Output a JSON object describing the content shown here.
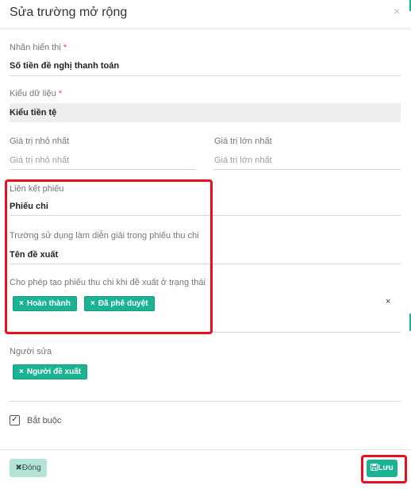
{
  "dialog": {
    "title": "Sửa trường mở rộng",
    "close_glyph": "×"
  },
  "fields": {
    "display_label": {
      "label": "Nhãn hiển thị",
      "required_mark": "*",
      "value": "Số tiền đề nghị thanh toán"
    },
    "data_type": {
      "label": "Kiểu dữ liệu",
      "required_mark": "*",
      "value": "Kiểu tiền tệ"
    },
    "min_value": {
      "label": "Giá trị nhỏ nhất",
      "placeholder": "Giá trị nhỏ nhất"
    },
    "max_value": {
      "label": "Giá trị lớn nhất",
      "placeholder": "Giá trị lớn nhất"
    },
    "voucher_link": {
      "label": "Liên kết phiếu",
      "value": "Phiếu chi"
    },
    "description_field": {
      "label": "Trường sử dụng làm diễn giải trong phiếu thu chi",
      "value": "Tên đề xuất"
    },
    "allowed_status": {
      "label": "Cho phép tạo phiếu thu chi khi đề xuất ở trạng thái",
      "tags": [
        "Hoàn thành",
        "Đã phê duyệt"
      ],
      "clear_glyph": "×"
    },
    "editor": {
      "label": "Người sửa",
      "tags": [
        "Người đề xuất"
      ]
    },
    "required_checkbox": {
      "label": "Bắt buộc",
      "checked": true,
      "check_glyph": "✓"
    }
  },
  "tag_remove_glyph": "×",
  "footer": {
    "close_button": {
      "icon": "close-icon",
      "label": "Đóng",
      "glyph": "✖"
    },
    "save_button": {
      "icon": "save-icon",
      "label": "Lưu"
    }
  },
  "colors": {
    "accent": "#1ab394",
    "required": "#e74c3c",
    "highlight_box": "#e8101e",
    "close_button_bg": "#b4e4d6"
  }
}
